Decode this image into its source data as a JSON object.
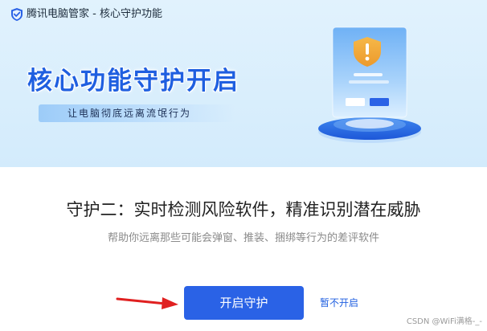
{
  "window": {
    "title": "腾讯电脑管家 - 核心守护功能"
  },
  "hero": {
    "title": "核心功能守护开启",
    "subtitle": "让电脑彻底远离流氓行为",
    "illustration_icon": "shield-warning-icon"
  },
  "content": {
    "heading": "守护二：实时检测风险软件，精准识别潜在威胁",
    "description": "帮助你远离那些可能会弹窗、推装、捆绑等行为的差评软件"
  },
  "actions": {
    "primary_label": "开启守护",
    "secondary_label": "暂不开启"
  },
  "watermark": "CSDN @WiFi满格-_-",
  "colors": {
    "accent": "#2a62e6",
    "hero_background": "#d9eefc",
    "arrow": "#e02020",
    "shield": "#f2a93a"
  }
}
